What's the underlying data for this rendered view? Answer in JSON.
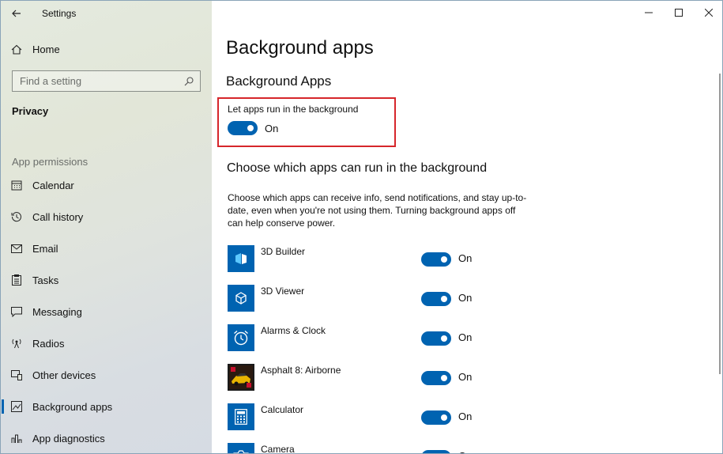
{
  "window": {
    "title": "Settings"
  },
  "sidebar": {
    "home_label": "Home",
    "search_placeholder": "Find a setting",
    "section_title": "Privacy",
    "group_label": "App permissions",
    "items": [
      {
        "label": "Calendar",
        "icon": "calendar-icon"
      },
      {
        "label": "Call history",
        "icon": "history-icon"
      },
      {
        "label": "Email",
        "icon": "mail-icon"
      },
      {
        "label": "Tasks",
        "icon": "tasks-icon"
      },
      {
        "label": "Messaging",
        "icon": "message-icon"
      },
      {
        "label": "Radios",
        "icon": "radio-icon"
      },
      {
        "label": "Other devices",
        "icon": "devices-icon"
      },
      {
        "label": "Background apps",
        "icon": "background-apps-icon",
        "active": true
      },
      {
        "label": "App diagnostics",
        "icon": "diagnostics-icon"
      }
    ]
  },
  "main": {
    "page_title": "Background apps",
    "subheading": "Background Apps",
    "master_toggle": {
      "label": "Let apps run in the background",
      "state": "On"
    },
    "heading2": "Choose which apps can run in the background",
    "description": "Choose which apps can receive info, send notifications, and stay up-to-date, even when you're not using them. Turning background apps off can help conserve power.",
    "apps": [
      {
        "name": "3D Builder",
        "state": "On",
        "icon": "3d-builder-icon"
      },
      {
        "name": "3D Viewer",
        "state": "On",
        "icon": "3d-viewer-icon"
      },
      {
        "name": "Alarms & Clock",
        "state": "On",
        "icon": "alarm-clock-icon"
      },
      {
        "name": "Asphalt 8: Airborne",
        "state": "On",
        "icon": "asphalt-icon"
      },
      {
        "name": "Calculator",
        "state": "On",
        "icon": "calculator-icon"
      },
      {
        "name": "Camera",
        "state": "On",
        "icon": "camera-icon"
      }
    ]
  },
  "colors": {
    "accent": "#0063b1",
    "highlight": "#d6262b"
  }
}
